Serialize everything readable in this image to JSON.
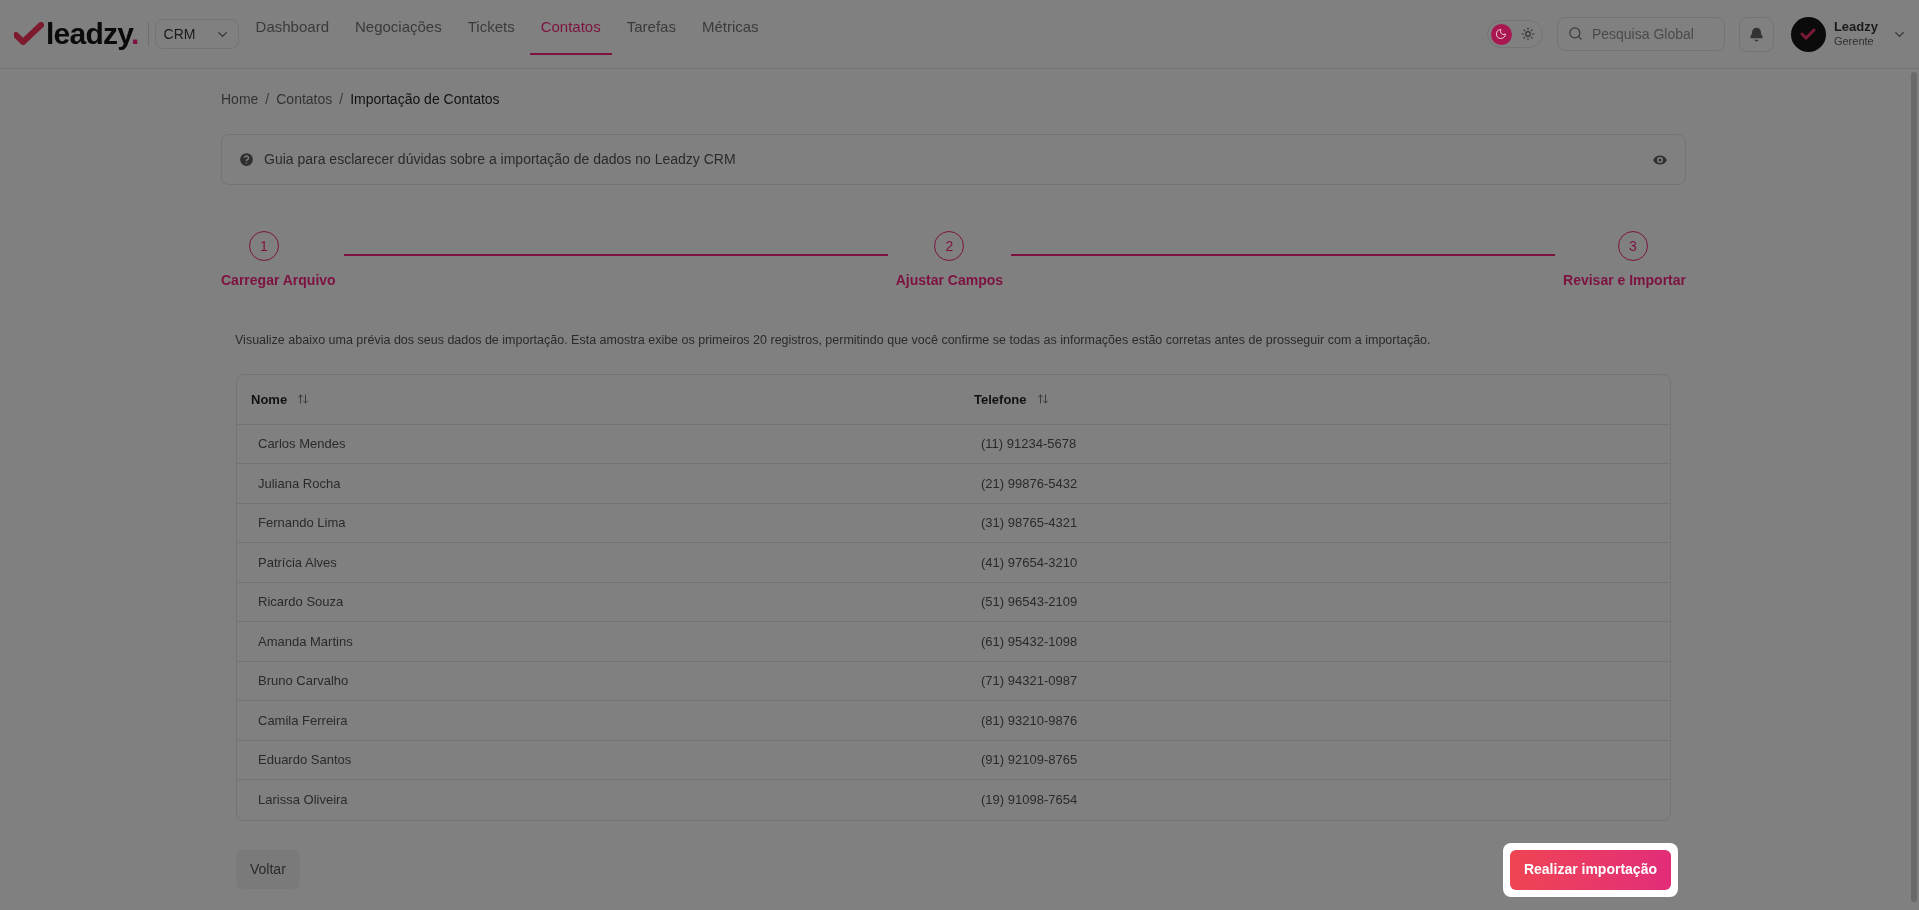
{
  "header": {
    "logo": {
      "name": "leadzy",
      "mark": "."
    },
    "app_select": "CRM",
    "nav": [
      {
        "label": "Dashboard",
        "selected": false
      },
      {
        "label": "Negociações",
        "selected": false
      },
      {
        "label": "Tickets",
        "selected": false
      },
      {
        "label": "Contatos",
        "selected": true
      },
      {
        "label": "Tarefas",
        "selected": false
      },
      {
        "label": "Métricas",
        "selected": false
      }
    ],
    "theme_toggle": {
      "dark": true
    },
    "search": {
      "placeholder": "Pesquisa Global"
    },
    "user": {
      "name": "Leadzy",
      "role": "Gerente"
    }
  },
  "breadcrumb": [
    {
      "label": "Home",
      "separator": "/"
    },
    {
      "label": "Contatos",
      "separator": "/"
    },
    {
      "label": "Importação de Contatos"
    }
  ],
  "guide": "Guia para esclarecer dúvidas sobre a importação de dados no Leadzy CRM",
  "steps": [
    {
      "number": "1",
      "label": "Carregar Arquivo",
      "done": true
    },
    {
      "number": "2",
      "label": "Ajustar Campos",
      "done": true
    },
    {
      "number": "3",
      "label": "Revisar e Importar",
      "done": true
    }
  ],
  "description": "Visualize abaixo uma prévia dos seus dados de importação. Esta amostra exibe os primeiros 20 registros, permitindo que você confirme se todas as informações estão corretas antes de prosseguir com a importação.",
  "table": {
    "columns": [
      "Nome",
      "Telefone"
    ],
    "rows": [
      [
        "Carlos Mendes",
        "(11) 91234-5678"
      ],
      [
        "Juliana Rocha",
        "(21) 99876-5432"
      ],
      [
        "Fernando Lima",
        "(31) 98765-4321"
      ],
      [
        "Patrícia Alves",
        "(41) 97654-3210"
      ],
      [
        "Ricardo Souza",
        "(51) 96543-2109"
      ],
      [
        "Amanda Martins",
        "(61) 95432-1098"
      ],
      [
        "Bruno Carvalho",
        "(71) 94321-0987"
      ],
      [
        "Camila Ferreira",
        "(81) 93210-9876"
      ],
      [
        "Eduardo Santos",
        "(91) 92109-8765"
      ],
      [
        "Larissa Oliveira",
        "(19) 91098-7654"
      ]
    ]
  },
  "buttons": {
    "back": "Voltar",
    "submit": {
      "label": "Realizar importação",
      "highlighted": true
    }
  }
}
